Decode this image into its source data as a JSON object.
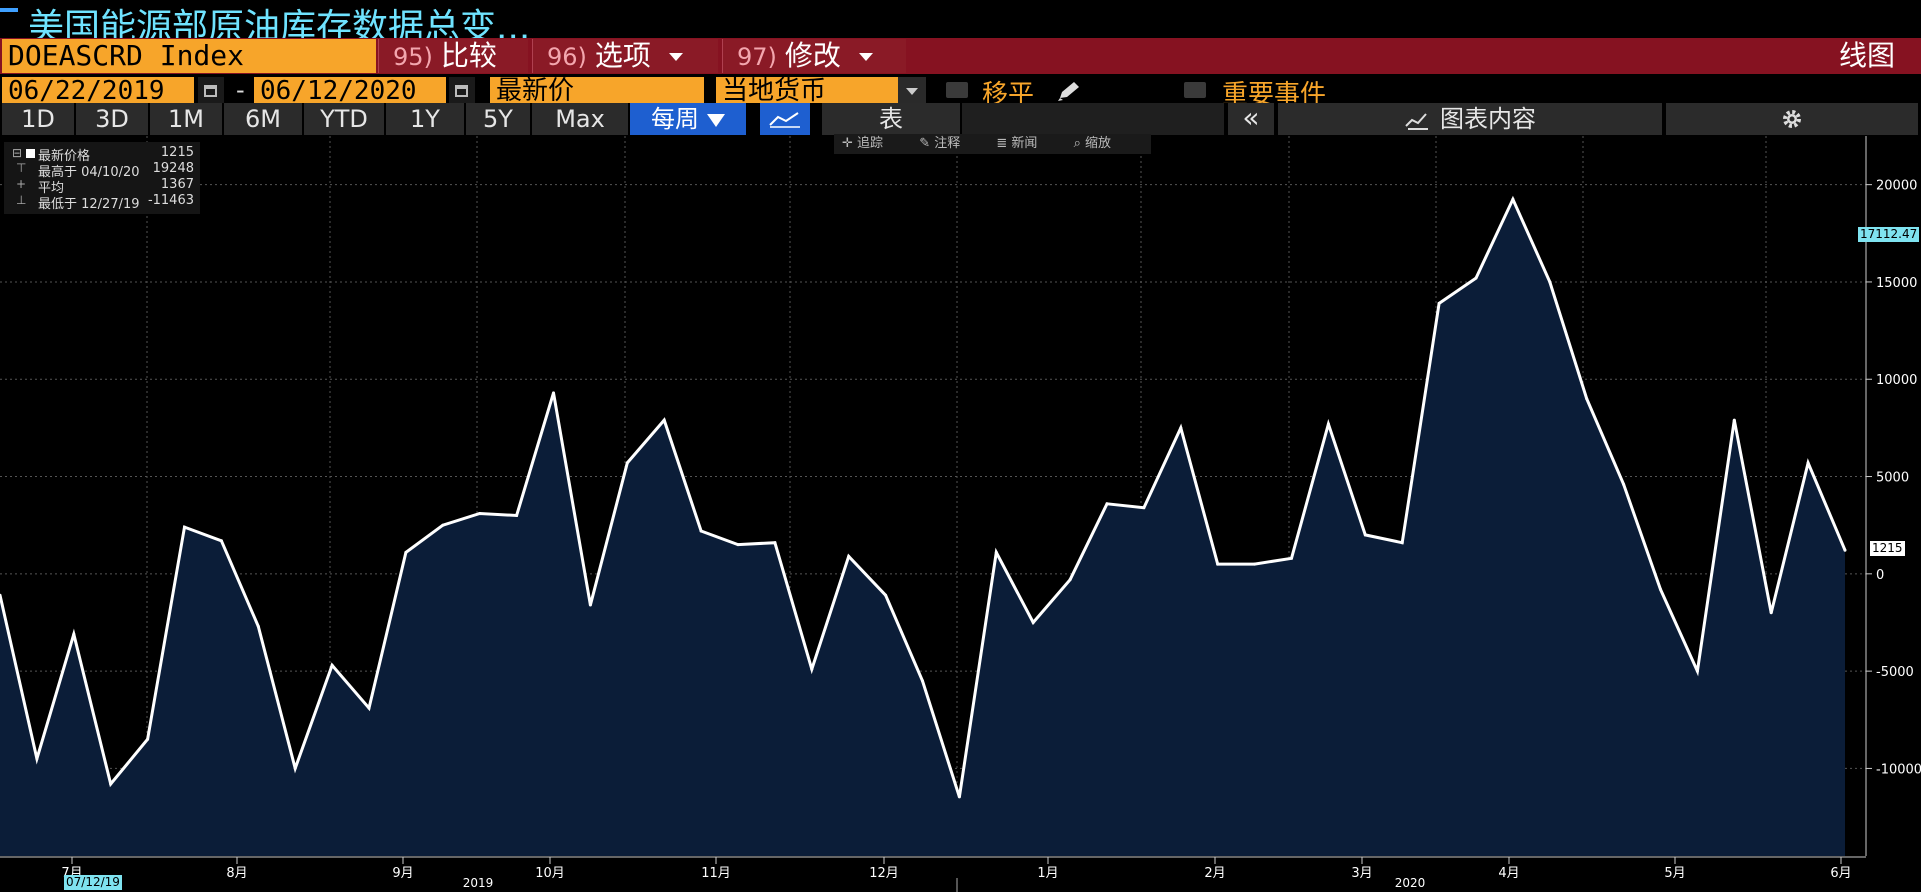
{
  "title": "美国能源部原油库存数据总变...",
  "toolbar": {
    "ticker": "DOEASCRD Index",
    "btn_compare": {
      "num": "95)",
      "label": "比较"
    },
    "btn_options": {
      "num": "96)",
      "label": "选项"
    },
    "btn_edit": {
      "num": "97)",
      "label": "修改"
    },
    "chart_type": "线图",
    "start_date": "06/22/2019",
    "dash": "-",
    "end_date": "06/12/2020",
    "price_field": "最新价",
    "currency": "当地货币",
    "moving_avg_label": "移平",
    "events_label": "重要事件"
  },
  "ranges": [
    "1D",
    "3D",
    "1M",
    "6M",
    "YTD",
    "1Y",
    "5Y",
    "Max"
  ],
  "period": "每周",
  "table_label": "表",
  "chart_content_label": "图表内容",
  "chart_tools": [
    "追踪",
    "注释",
    "新闻",
    "缩放"
  ],
  "legend": [
    {
      "label": "最新价格",
      "date": "",
      "value": "1215"
    },
    {
      "label": "最高于 04/10/20",
      "date": "",
      "value": "19248"
    },
    {
      "label": "平均",
      "date": "",
      "value": "1367"
    },
    {
      "label": "最低于 12/27/19",
      "date": "",
      "value": "-11463"
    }
  ],
  "badges": {
    "last_value": "1215",
    "crosshair_value": "17112.47",
    "start_date_badge": "07/12/19"
  },
  "colors": {
    "accent": "#f7a52a",
    "toolbar_red": "#861221",
    "area_fill": "#0b1d38",
    "line": "#ffffff",
    "badge": "#7fe3f0"
  },
  "chart_data": {
    "type": "area",
    "title": "",
    "ylim": [
      -14500,
      22500
    ],
    "y_ticks": [
      20000,
      15000,
      10000,
      5000,
      0,
      -5000,
      -10000
    ],
    "y_tick_labels": [
      "20000",
      "15000",
      "10000",
      "5000",
      "0",
      "-5000",
      "-10000"
    ],
    "x_month_labels": [
      "7月",
      "8月",
      "9月",
      "10月",
      "11月",
      "12月",
      "1月",
      "2月",
      "3月",
      "4月",
      "5月",
      "6月"
    ],
    "x_year_labels": [
      "2019",
      "2020"
    ],
    "grid": true,
    "series": [
      {
        "values": [
          -1100,
          -9500,
          -3100,
          -10800,
          -8500,
          2400,
          1700,
          -2700,
          -10000,
          -4700,
          -6900,
          1100,
          2500,
          3100,
          3000,
          9300,
          -1600,
          5700,
          7900,
          2200,
          1500,
          1600,
          -4900,
          900,
          -1100,
          -5500,
          -11463,
          1100,
          -2500,
          -300,
          3600,
          3400,
          7500,
          500,
          500,
          800,
          7700,
          2000,
          1600,
          13900,
          15200,
          19248,
          15000,
          9000,
          4600,
          -800,
          -5000,
          7900,
          -2000,
          5700,
          1215
        ]
      }
    ]
  }
}
